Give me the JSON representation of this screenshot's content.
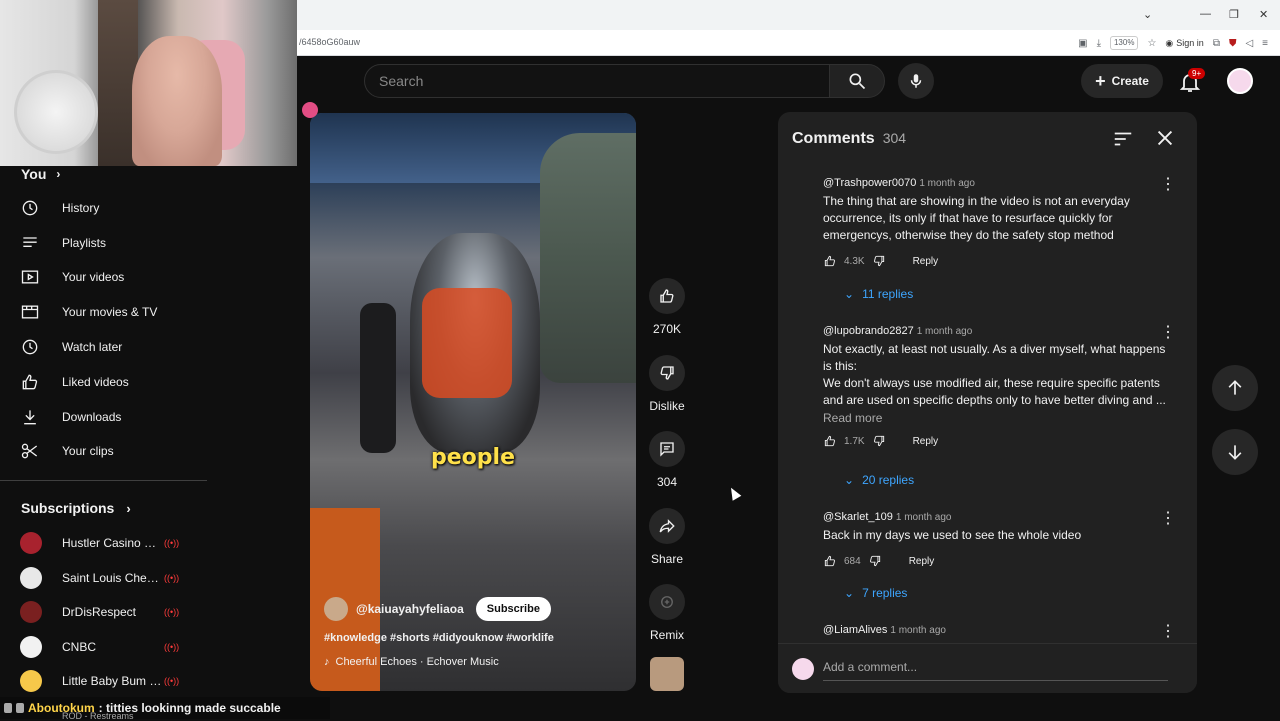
{
  "browser": {
    "url": "/6458oG60auw",
    "zoom": "130%",
    "sign_in": "Sign in"
  },
  "header": {
    "search_placeholder": "Search",
    "create_label": "Create",
    "notif_badge": "9+"
  },
  "sidebar": {
    "you_label": "You",
    "items": [
      {
        "label": "History",
        "icon": "history-icon"
      },
      {
        "label": "Playlists",
        "icon": "playlists-icon"
      },
      {
        "label": "Your videos",
        "icon": "your-videos-icon"
      },
      {
        "label": "Your movies & TV",
        "icon": "movies-icon"
      },
      {
        "label": "Watch later",
        "icon": "watch-later-icon"
      },
      {
        "label": "Liked videos",
        "icon": "like-icon"
      },
      {
        "label": "Downloads",
        "icon": "download-icon"
      },
      {
        "label": "Your clips",
        "icon": "scissors-icon"
      }
    ],
    "subscriptions_label": "Subscriptions",
    "subscriptions": [
      {
        "name": "Hustler Casino Li...",
        "color": "#a8222e",
        "live": true
      },
      {
        "name": "Saint Louis Ches...",
        "color": "#e8e8e8",
        "live": true
      },
      {
        "name": "DrDisRespect",
        "color": "#7a2020",
        "live": true
      },
      {
        "name": "CNBC",
        "color": "#f1f1f1",
        "live": true
      },
      {
        "name": "Little Baby Bum -...",
        "color": "#f6c84a",
        "live": true
      }
    ],
    "restreams_label": "ROD - Restreams"
  },
  "chat_overlay": {
    "user": "Aboutokum",
    "message": ": titties lookinng made succable"
  },
  "video": {
    "caption": "people",
    "channel": "@kaiuayahyfeliaoa",
    "subscribe_label": "Subscribe",
    "tags": "#knowledge #shorts #didyouknow #worklife",
    "music": "Cheerful Echoes · Echover Music"
  },
  "actions": {
    "like_count": "270K",
    "dislike_label": "Dislike",
    "comment_count": "304",
    "share_label": "Share",
    "remix_label": "Remix"
  },
  "comments": {
    "title": "Comments",
    "count": "304",
    "items": [
      {
        "user": "@Trashpower0070",
        "time": "1 month ago",
        "text": "The thing that are showing in the video is not an everyday occurrence, its only if that have to resurface quickly for emergencys, otherwise they do the safety stop method",
        "likes": "4.3K",
        "reply_label": "Reply",
        "replies": "11 replies"
      },
      {
        "user": "@lupobrando2827",
        "time": "1 month ago",
        "text": "Not exactly, at least not usually. As a diver myself, what happens is this:\nWe don't always use modified air, these require specific patents and are used on specific depths only to have better diving and ...",
        "read_more": "Read more",
        "likes": "1.7K",
        "reply_label": "Reply",
        "replies": "20 replies"
      },
      {
        "user": "@Skarlet_109",
        "time": "1 month ago",
        "text": "Back in my days we used to see the whole video",
        "likes": "684",
        "reply_label": "Reply",
        "replies": "7 replies"
      },
      {
        "user": "@LiamAlives",
        "time": "1 month ago"
      }
    ],
    "add_placeholder": "Add a comment..."
  }
}
